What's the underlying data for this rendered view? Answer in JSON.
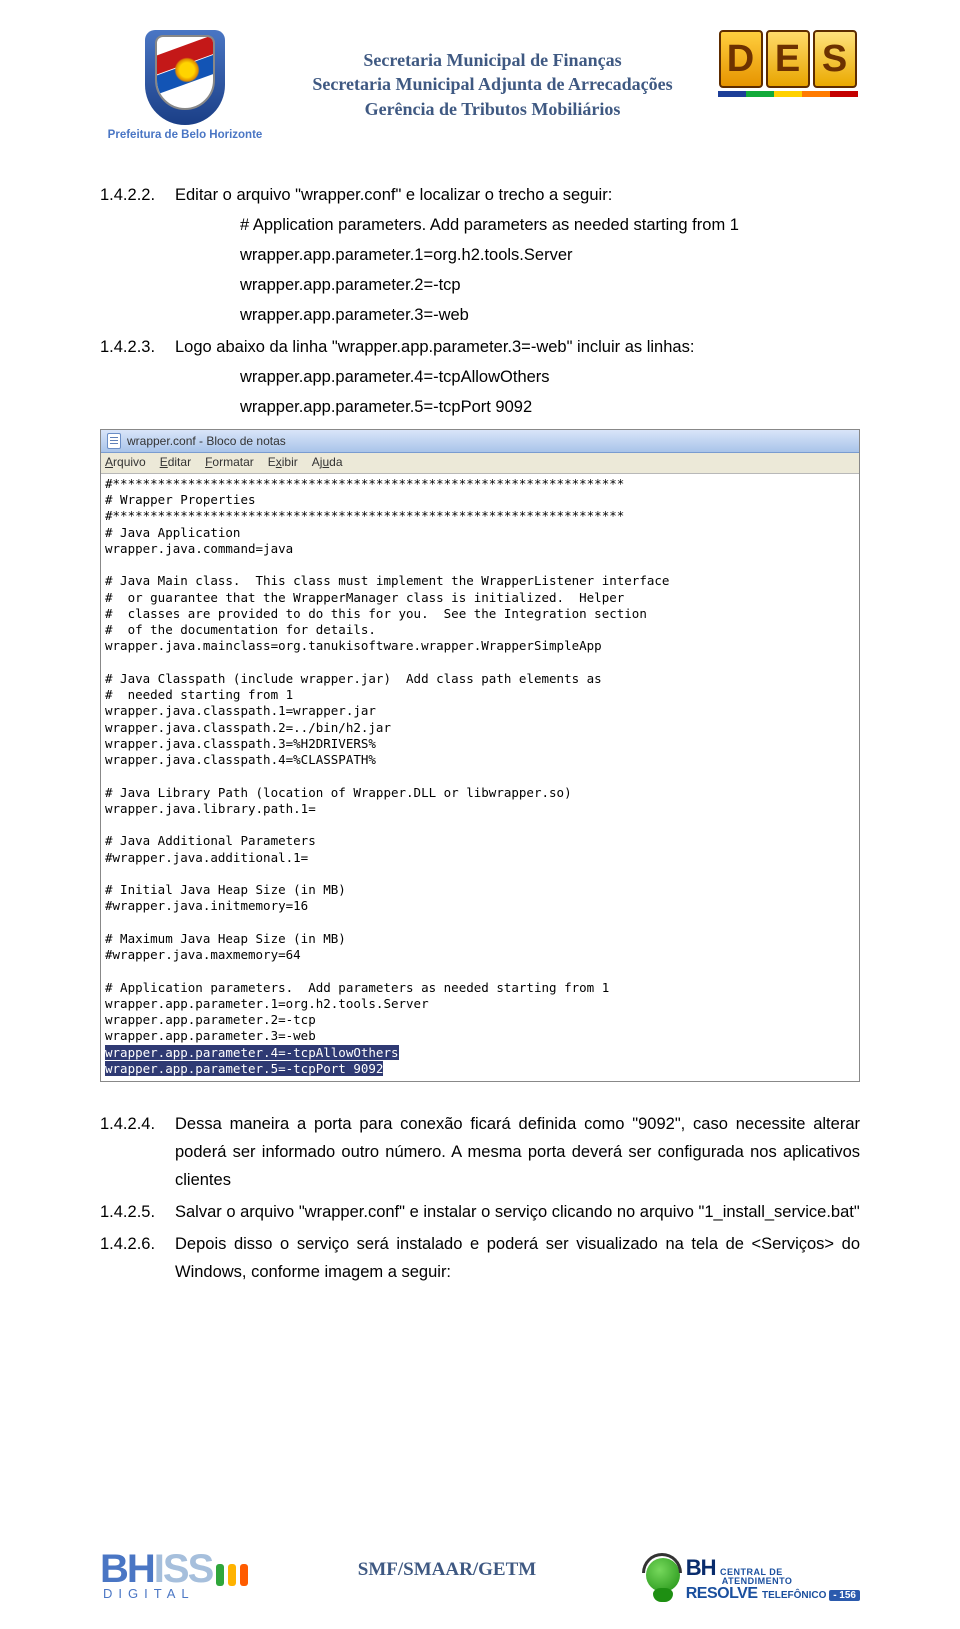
{
  "header": {
    "municipio": "Prefeitura de Belo Horizonte",
    "line1": "Secretaria Municipal de Finanças",
    "line2": "Secretaria Municipal Adjunta de Arrecadações",
    "line3": "Gerência de Tributos Mobiliários",
    "des_d": "D",
    "des_e": "E",
    "des_s": "S"
  },
  "steps": {
    "s1_num": "1.4.2.2.",
    "s1_txt": "Editar o arquivo \"wrapper.conf\" e localizar o trecho a seguir:",
    "s1_code1": "# Application parameters.  Add parameters as needed starting from 1",
    "s1_code2": "wrapper.app.parameter.1=org.h2.tools.Server",
    "s1_code3": "wrapper.app.parameter.2=-tcp",
    "s1_code4": "wrapper.app.parameter.3=-web",
    "s2_num": "1.4.2.3.",
    "s2_txt": "Logo abaixo da linha \"wrapper.app.parameter.3=-web\" incluir as linhas:",
    "s2_code1": "wrapper.app.parameter.4=-tcpAllowOthers",
    "s2_code2": "wrapper.app.parameter.5=-tcpPort 9092"
  },
  "notepad": {
    "title": "wrapper.conf - Bloco de notas",
    "menu": {
      "m1": "Arquivo",
      "m2": "Editar",
      "m3": "Formatar",
      "m4": "Exibir",
      "m5": "Ajuda"
    },
    "body": "#********************************************************************\n# Wrapper Properties\n#********************************************************************\n# Java Application\nwrapper.java.command=java\n\n# Java Main class.  This class must implement the WrapperListener interface\n#  or guarantee that the WrapperManager class is initialized.  Helper\n#  classes are provided to do this for you.  See the Integration section\n#  of the documentation for details.\nwrapper.java.mainclass=org.tanukisoftware.wrapper.WrapperSimpleApp\n\n# Java Classpath (include wrapper.jar)  Add class path elements as\n#  needed starting from 1\nwrapper.java.classpath.1=wrapper.jar\nwrapper.java.classpath.2=../bin/h2.jar\nwrapper.java.classpath.3=%H2DRIVERS%\nwrapper.java.classpath.4=%CLASSPATH%\n\n# Java Library Path (location of Wrapper.DLL or libwrapper.so)\nwrapper.java.library.path.1=\n\n# Java Additional Parameters\n#wrapper.java.additional.1=\n\n# Initial Java Heap Size (in MB)\n#wrapper.java.initmemory=16\n\n# Maximum Java Heap Size (in MB)\n#wrapper.java.maxmemory=64\n\n# Application parameters.  Add parameters as needed starting from 1\nwrapper.app.parameter.1=org.h2.tools.Server\nwrapper.app.parameter.2=-tcp\nwrapper.app.parameter.3=-web",
    "hl1": "wrapper.app.parameter.4=-tcpAllowOthers",
    "hl2": "wrapper.app.parameter.5=-tcpPort 9092"
  },
  "lower": {
    "s4_num": "1.4.2.4.",
    "s4_txt": "Dessa maneira a porta para conexão ficará definida como \"9092\", caso necessite alterar poderá ser informado outro número. A mesma porta deverá ser configurada nos aplicativos clientes",
    "s5_num": "1.4.2.5.",
    "s5_txt": "Salvar o arquivo \"wrapper.conf\" e instalar o serviço clicando no arquivo \"1_install_service.bat\"",
    "s6_num": "1.4.2.6.",
    "s6_txt": "Depois disso o serviço será instalado e poderá ser visualizado na tela de <Serviços> do Windows, conforme imagem a seguir:"
  },
  "footer": {
    "bhiss_bh": "BH",
    "bhiss_iss": "ISS",
    "bhiss_sub": "DIGITAL",
    "center": "SMF/SMAAR/GETM",
    "r_bh": "BH",
    "r_central": "CENTRAL DE",
    "r_atend": "ATENDIMENTO",
    "r_resolve": "RESOLVE",
    "r_tel": "TELEFÔNICO ",
    "r_num": "- 156"
  }
}
